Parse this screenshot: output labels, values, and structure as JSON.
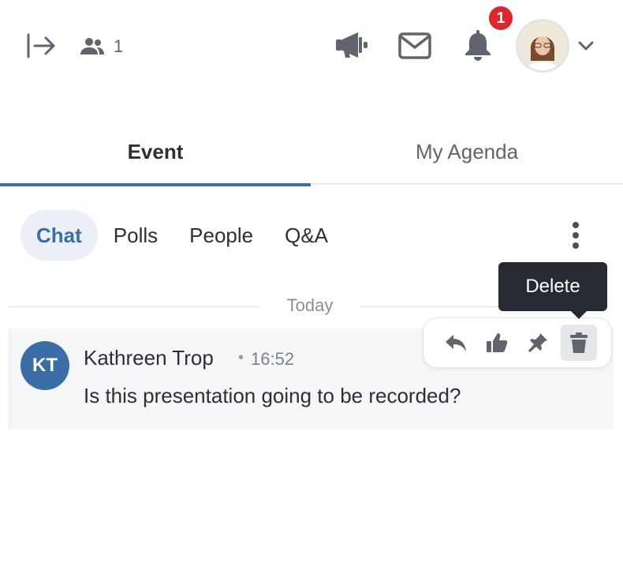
{
  "header": {
    "participant_count": "1",
    "notification_count": "1",
    "icons": [
      "expand-panel-icon",
      "people-icon",
      "megaphone-icon",
      "mail-icon",
      "bell-icon",
      "chevron-down-icon"
    ]
  },
  "tabs": [
    {
      "label": "Event",
      "active": true
    },
    {
      "label": "My Agenda",
      "active": false
    }
  ],
  "subtabs": [
    {
      "label": "Chat",
      "active": true
    },
    {
      "label": "Polls",
      "active": false
    },
    {
      "label": "People",
      "active": false
    },
    {
      "label": "Q&A",
      "active": false
    }
  ],
  "chat": {
    "date_separator": "Today",
    "messages": [
      {
        "initials": "KT",
        "author": "Kathreen Trop",
        "separator": "•",
        "time": "16:52",
        "text": "Is this presentation going to be recorded?"
      }
    ],
    "actions": [
      "reply-icon",
      "thumbs-up-icon",
      "pin-icon",
      "trash-icon"
    ],
    "tooltip": "Delete"
  },
  "colors": {
    "accent": "#3a6ea6",
    "badge": "#e0252c",
    "tooltip_bg": "#262a33"
  }
}
